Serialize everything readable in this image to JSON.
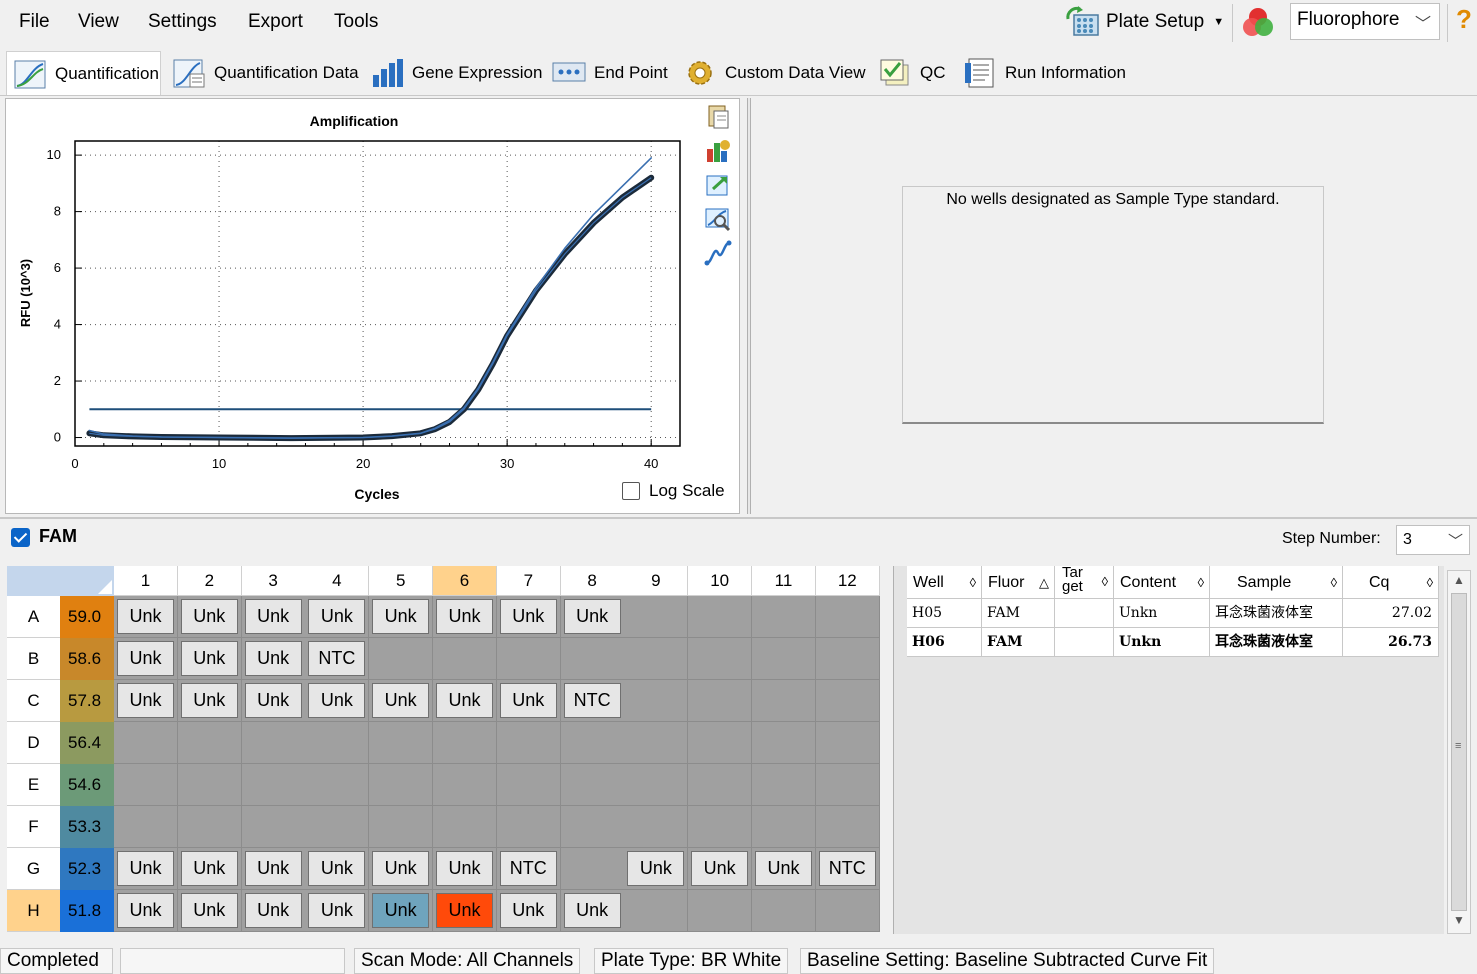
{
  "menu": [
    "File",
    "View",
    "Settings",
    "Export",
    "Tools"
  ],
  "toolbar": {
    "plate_setup_label": "Plate Setup",
    "fluorophore_value": "Fluorophore",
    "help_glyph": "?"
  },
  "tabs": [
    "Quantification",
    "Quantification Data",
    "Gene Expression",
    "End Point",
    "Custom Data View",
    "QC",
    "Run Information"
  ],
  "chart_data": {
    "type": "line",
    "title": "Amplification",
    "xlabel": "Cycles",
    "ylabel": "RFU (10^3)",
    "xlim": [
      0,
      42
    ],
    "ylim": [
      -0.3,
      10.5
    ],
    "xticks": [
      0,
      10,
      20,
      30,
      40
    ],
    "yticks": [
      0,
      2,
      4,
      6,
      8,
      10
    ],
    "grid": true,
    "threshold": 1.0,
    "series": [
      {
        "x": [
          1,
          2,
          4,
          6,
          10,
          15,
          20,
          22,
          24,
          25,
          26,
          27,
          28,
          29,
          30,
          32,
          34,
          36,
          38,
          40
        ],
        "values": [
          0.15,
          0.08,
          0.04,
          0.02,
          0.0,
          -0.02,
          0.0,
          0.05,
          0.15,
          0.3,
          0.55,
          1.0,
          1.7,
          2.6,
          3.6,
          5.2,
          6.5,
          7.6,
          8.5,
          9.2
        ],
        "color": "#1b2a3a"
      },
      {
        "x": [
          1,
          2,
          4,
          6,
          10,
          15,
          20,
          22,
          24,
          25,
          26,
          27,
          28,
          29,
          30,
          32,
          34,
          36,
          38,
          40
        ],
        "values": [
          0.25,
          0.12,
          0.05,
          0.02,
          0.0,
          -0.02,
          0.0,
          0.05,
          0.15,
          0.33,
          0.6,
          1.05,
          1.75,
          2.65,
          3.65,
          5.3,
          6.7,
          7.9,
          8.9,
          9.9
        ],
        "color": "#3a6fb0"
      }
    ]
  },
  "log_scale_label": "Log Scale",
  "standard_message": "No wells designated as Sample Type standard.",
  "fluor_strip": {
    "fam_label": "FAM",
    "step_number_label": "Step Number:",
    "step_number_value": "3"
  },
  "plate": {
    "columns": [
      "1",
      "2",
      "3",
      "4",
      "5",
      "6",
      "7",
      "8",
      "9",
      "10",
      "11",
      "12"
    ],
    "rows": [
      "A",
      "B",
      "C",
      "D",
      "E",
      "F",
      "G",
      "H"
    ],
    "temps": [
      "59.0",
      "58.6",
      "57.8",
      "56.4",
      "54.6",
      "53.3",
      "52.3",
      "51.8"
    ],
    "temp_colors": [
      "#e08010",
      "#c8882a",
      "#b89a40",
      "#8c9a60",
      "#6c9a78",
      "#4f8aa0",
      "#2f78c0",
      "#1a70d8"
    ],
    "wells": [
      [
        "Unk",
        "Unk",
        "Unk",
        "Unk",
        "Unk",
        "Unk",
        "Unk",
        "Unk",
        "",
        "",
        "",
        ""
      ],
      [
        "Unk",
        "Unk",
        "Unk",
        "NTC",
        "",
        "",
        "",
        "",
        "",
        "",
        "",
        ""
      ],
      [
        "Unk",
        "Unk",
        "Unk",
        "Unk",
        "Unk",
        "Unk",
        "Unk",
        "NTC",
        "",
        "",
        "",
        ""
      ],
      [
        "",
        "",
        "",
        "",
        "",
        "",
        "",
        "",
        "",
        "",
        "",
        ""
      ],
      [
        "",
        "",
        "",
        "",
        "",
        "",
        "",
        "",
        "",
        "",
        "",
        ""
      ],
      [
        "",
        "",
        "",
        "",
        "",
        "",
        "",
        "",
        "",
        "",
        "",
        ""
      ],
      [
        "Unk",
        "Unk",
        "Unk",
        "Unk",
        "Unk",
        "Unk",
        "NTC",
        "",
        "Unk",
        "Unk",
        "Unk",
        "NTC"
      ],
      [
        "Unk",
        "Unk",
        "Unk",
        "Unk",
        "Unk",
        "Unk",
        "Unk",
        "Unk",
        "",
        "",
        "",
        ""
      ]
    ],
    "highlighted_well": "H6",
    "selected_well": "H5",
    "highlight_color": "#ff4a0a",
    "selected_color": "#6fa4bd",
    "header_highlight_color": "#ffd28c"
  },
  "results": {
    "headers": [
      "Well",
      "Fluor",
      "Tar get",
      "Content",
      "Sample",
      "Cq"
    ],
    "rows": [
      {
        "well": "H05",
        "fluor": "FAM",
        "target": "",
        "content": "Unkn",
        "sample": "耳念珠菌液体室",
        "cq": "27.02",
        "bold": false
      },
      {
        "well": "H06",
        "fluor": "FAM",
        "target": "",
        "content": "Unkn",
        "sample": "耳念珠菌液体室",
        "cq": "26.73",
        "bold": true
      }
    ]
  },
  "status": {
    "state": "Completed",
    "scan_mode": "Scan Mode: All Channels",
    "plate_type": "Plate Type: BR White",
    "baseline": "Baseline Setting: Baseline Subtracted Curve Fit"
  }
}
